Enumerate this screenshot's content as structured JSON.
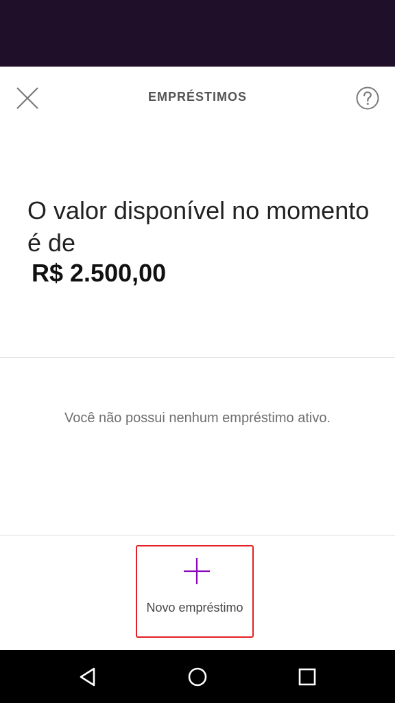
{
  "header": {
    "title": "EMPRÉSTIMOS",
    "close_icon": "close-icon",
    "help_icon": "help-icon"
  },
  "summary": {
    "headline": "O valor disponível no momento é de",
    "amount": "R$ 2.500,00"
  },
  "loans": {
    "empty_message": "Você não possui nenhum empréstimo ativo."
  },
  "actions": {
    "new_loan_label": "Novo empréstimo",
    "new_loan_icon": "plus-icon"
  },
  "nav": {
    "back_icon": "back-icon",
    "home_icon": "home-icon",
    "recents_icon": "recents-icon"
  },
  "colors": {
    "top_bar": "#1f0f28",
    "accent": "#8a05be",
    "highlight_border": "#e31e24"
  }
}
